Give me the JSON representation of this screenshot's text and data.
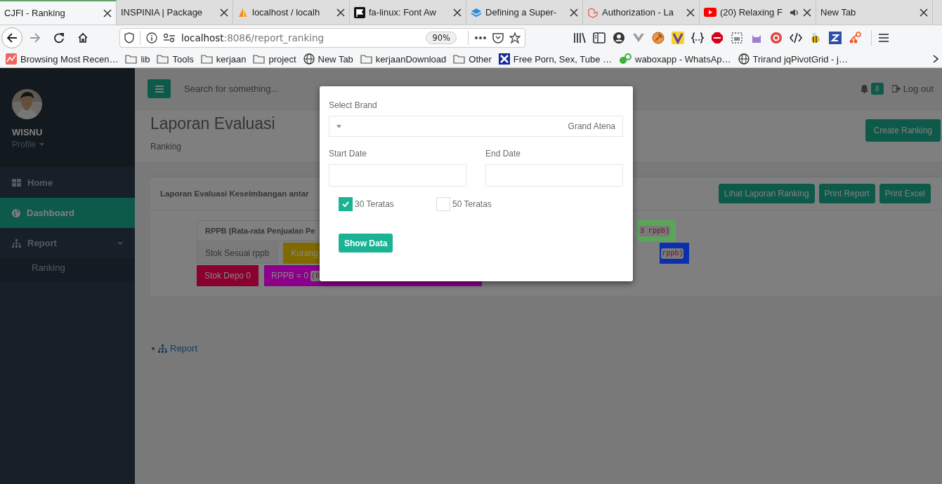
{
  "browser": {
    "tabs": [
      {
        "title": "CJFI - Ranking",
        "selected": true,
        "kind": "none"
      },
      {
        "title": "INSPINIA | Package",
        "selected": false,
        "kind": "none"
      },
      {
        "title": "localhost / localh",
        "selected": false,
        "kind": "sails"
      },
      {
        "title": "fa-linux: Font Aw",
        "selected": false,
        "kind": "flag"
      },
      {
        "title": "Defining a Super-",
        "selected": false,
        "kind": "stack"
      },
      {
        "title": "Authorization - La",
        "selected": false,
        "kind": "cube"
      },
      {
        "title": "(20) Relaxing F",
        "selected": false,
        "kind": "play",
        "audio": true
      },
      {
        "title": "New Tab",
        "selected": false,
        "kind": "none"
      }
    ],
    "url_host": "localhost",
    "url_path": ":8086/report_ranking",
    "zoom": "90%",
    "bookmarks": [
      {
        "label": "Browsing Most Recen…",
        "kind": "chart"
      },
      {
        "label": "lib",
        "kind": "folder"
      },
      {
        "label": "Tools",
        "kind": "folder"
      },
      {
        "label": "kerjaan",
        "kind": "folder"
      },
      {
        "label": "project",
        "kind": "folder"
      },
      {
        "label": "New Tab",
        "kind": "globe"
      },
      {
        "label": "kerjaanDownload",
        "kind": "folder"
      },
      {
        "label": "Other",
        "kind": "folder"
      },
      {
        "label": "Free Porn, Sex, Tube …",
        "kind": "cross"
      },
      {
        "label": "waboxapp - WhatsAp…",
        "kind": "chat"
      },
      {
        "label": "Trirand jqPivotGrid - j…",
        "kind": "globe"
      }
    ]
  },
  "sidebar": {
    "user": "WISNU",
    "profile": "Profile",
    "menu": [
      {
        "label": "Home",
        "selected": false,
        "kind": "grid"
      },
      {
        "label": "Dashboard",
        "selected": true,
        "kind": "globe"
      },
      {
        "label": "Report",
        "selected": false,
        "kind": "sitemap",
        "expanded": true,
        "children": [
          {
            "label": "Ranking",
            "selected": false
          }
        ]
      }
    ]
  },
  "topbar": {
    "search_placeholder": "Search for something...",
    "notification_count": "8",
    "logout": "Log out"
  },
  "header": {
    "title": "Laporan Evaluasi",
    "breadcrumb": "Ranking",
    "button": "Create Ranking"
  },
  "card": {
    "title": "Laporan Evaluasi Keseimbangan antar",
    "buttons": [
      "Lihat Laporan Ranking",
      "Print Report",
      "Print Excel"
    ],
    "legend_rows": [
      {
        "left": [
          {
            "kind": "heading",
            "text": "RPPB (Rata-rata Penjualan Pe",
            "color": "#808080"
          }
        ],
        "right": [
          {
            "kind": "swatch",
            "code": "3 rppb)",
            "color": "#5aa55a"
          }
        ]
      },
      {
        "left": [
          {
            "kind": "plain",
            "text": "Stok Sesuai rppb",
            "color": "#7a7a7a"
          },
          {
            "kind": "swatch",
            "text": "Kurang",
            "color": "#7f6a00"
          }
        ],
        "right": [
          {
            "kind": "swatch",
            "code": "rppb)",
            "color": "#0a30b0"
          }
        ]
      },
      {
        "left": [
          {
            "kind": "swatch",
            "text": "Stok Depo 0",
            "color": "#8a0030"
          },
          {
            "kind": "swatch",
            "text": "RPPB = 0",
            "code": "(6",
            "color": "#8c008c"
          }
        ],
        "right": []
      }
    ]
  },
  "footer_link": "Report",
  "modal": {
    "brand_label": "Select Brand",
    "brand_value": "Grand Atena",
    "start_label": "Start Date",
    "end_label": "End Date",
    "checkboxes": [
      {
        "label": "30 Teratas",
        "checked": true
      },
      {
        "label": "50 Teratas",
        "checked": false
      }
    ],
    "button": "Show Data"
  }
}
